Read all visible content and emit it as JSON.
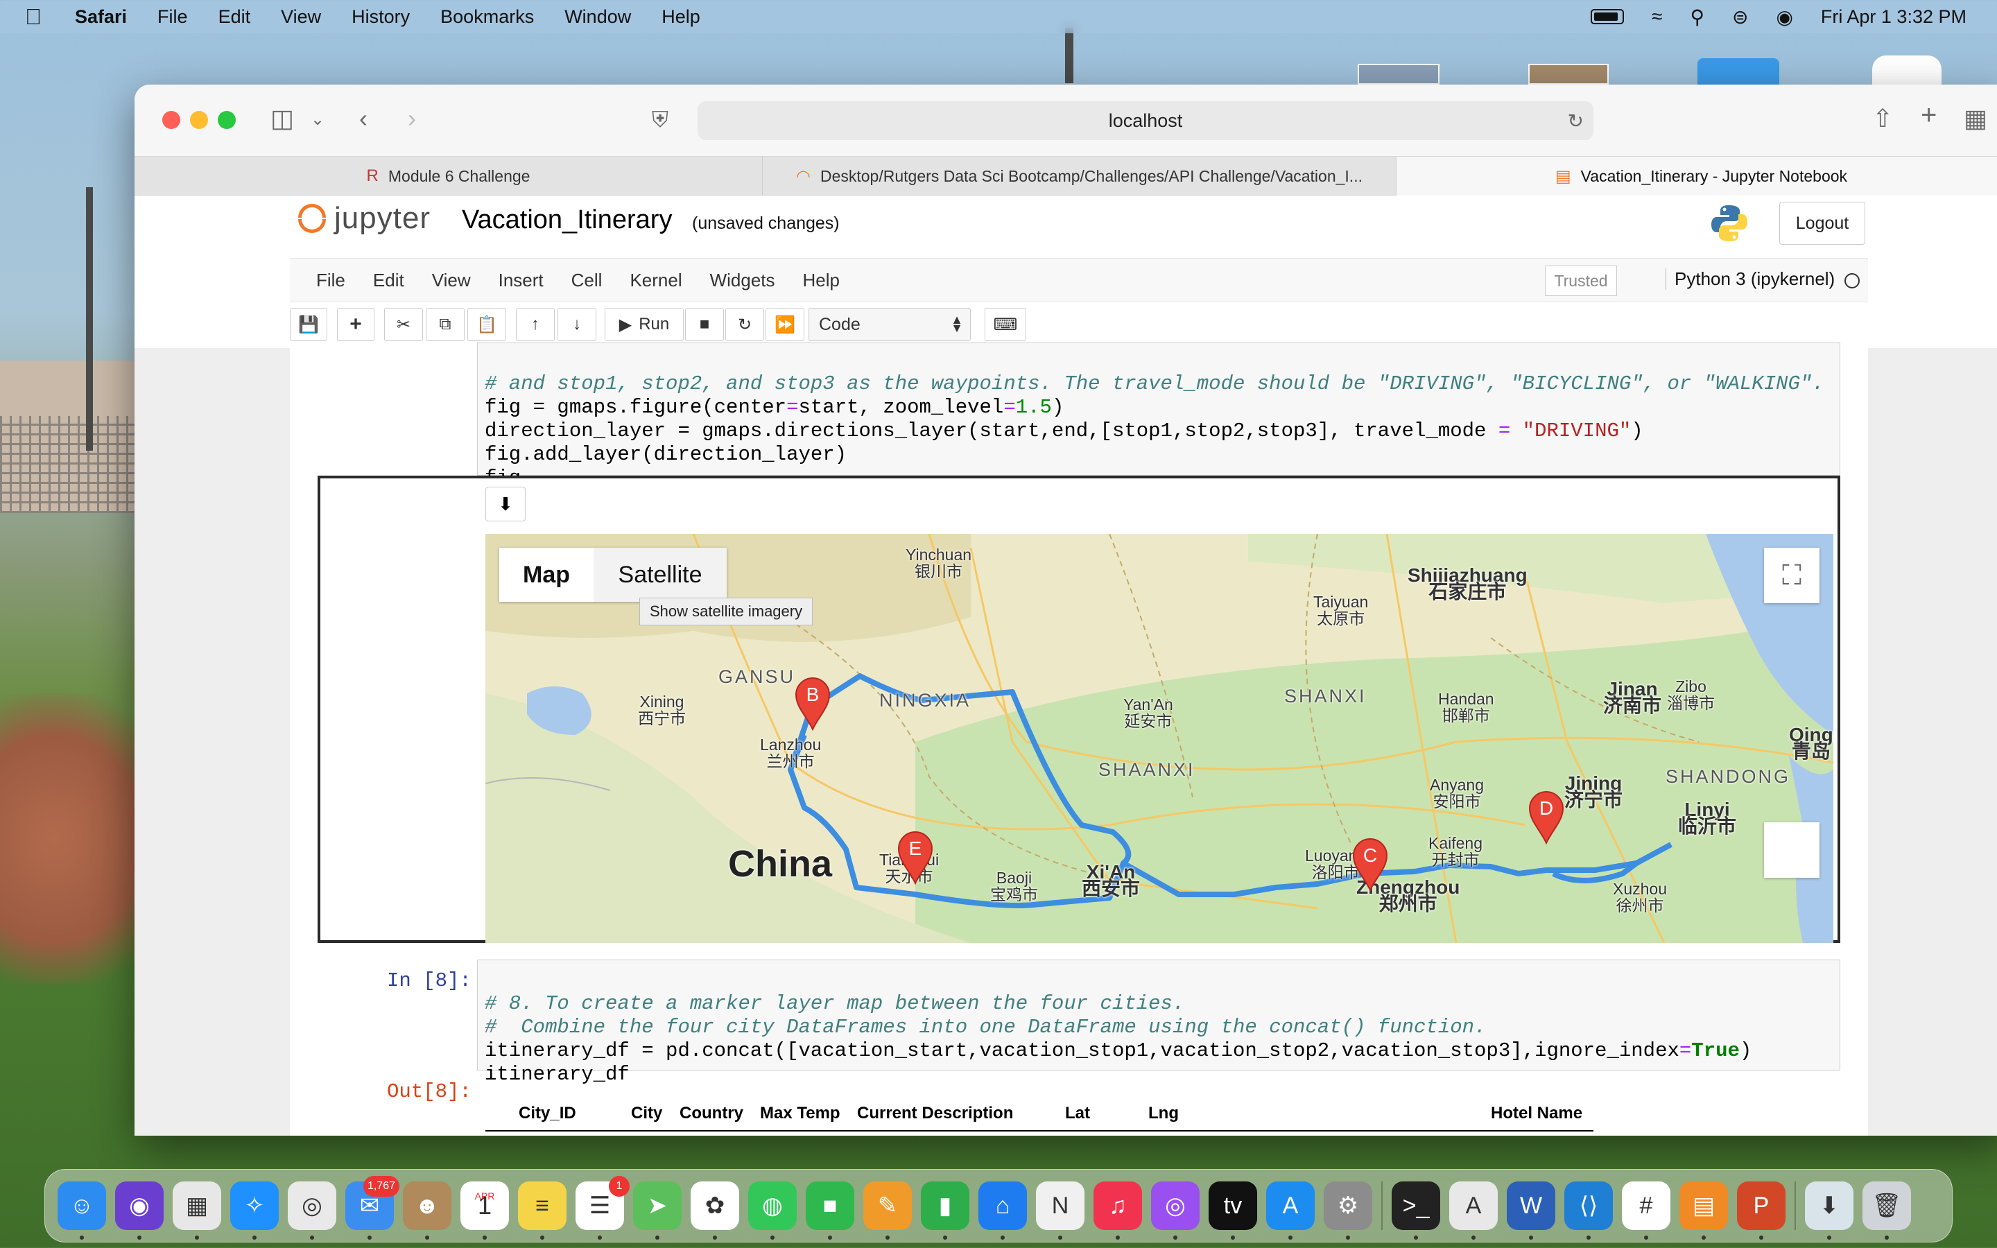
{
  "menubar": {
    "app": "Safari",
    "items": [
      "File",
      "Edit",
      "View",
      "History",
      "Bookmarks",
      "Window",
      "Help"
    ],
    "clock": "Fri Apr 1  3:32 PM"
  },
  "browser": {
    "url": "localhost",
    "tabs": [
      {
        "label": "Module 6 Challenge",
        "icon": "r-icon"
      },
      {
        "label": "Desktop/Rutgers Data Sci Bootcamp/Challenges/API Challenge/Vacation_I...",
        "icon": "jupyter-icon"
      },
      {
        "label": "Vacation_Itinerary - Jupyter Notebook",
        "icon": "notebook-icon"
      }
    ]
  },
  "jupyter": {
    "logo_text": "jupyter",
    "notebook_title": "Vacation_Itinerary",
    "status": "(unsaved changes)",
    "logout": "Logout",
    "menu": [
      "File",
      "Edit",
      "View",
      "Insert",
      "Cell",
      "Kernel",
      "Widgets",
      "Help"
    ],
    "trusted": "Trusted",
    "kernel": "Python 3 (ipykernel)",
    "toolbar": {
      "run_label": "Run",
      "cell_type": "Code"
    }
  },
  "cells": {
    "cell7": {
      "line1_comment": "# and stop1, stop2, and stop3 as the waypoints. The travel_mode should be \"DRIVING\", \"BICYCLING\", or \"WALKING\".",
      "line2_a": "fig = gmaps.figure(center",
      "line2_op": "=",
      "line2_b": "start, zoom_level",
      "line2_op2": "=",
      "line2_num": "1.5",
      "line2_c": ")",
      "line3_a": "direction_layer = gmaps.directions_layer(start,end,[stop1,stop2,stop3], travel_mode ",
      "line3_op": "=",
      "line3_str": "\"DRIVING\"",
      "line3_b": ")",
      "line4": "fig.add_layer(direction_layer)",
      "line5": "fig"
    },
    "cell8": {
      "prompt": "In [8]:",
      "line1": "# 8. To create a marker layer map between the four cities.",
      "line2": "#  Combine the four city DataFrames into one DataFrame using the concat() function.",
      "line3_a": "itinerary_df = pd.concat([vacation_start,vacation_stop1,vacation_stop2,vacation_stop3],ignore_index",
      "line3_op": "=",
      "line3_kw": "True",
      "line3_b": ")",
      "line4": "itinerary_df",
      "out_prompt": "Out[8]:"
    }
  },
  "map": {
    "type_map": "Map",
    "type_satellite": "Satellite",
    "tooltip": "Show satellite imagery",
    "markers": [
      "B",
      "E",
      "C",
      "D"
    ],
    "labels": {
      "yinchuan_en": "Yinchuan",
      "yinchuan_zh": "银川市",
      "shijiazhuang_en": "Shijiazhuang",
      "shijiazhuang_zh": "石家庄市",
      "taiyuan_en": "Taiyuan",
      "taiyuan_zh": "太原市",
      "gansu": "GANSU",
      "ningxia": "NINGXIA",
      "xining_en": "Xining",
      "xining_zh": "西宁市",
      "lanzhou_en": "Lanzhou",
      "lanzhou_zh": "兰州市",
      "yanan_en": "Yan'An",
      "yanan_zh": "延安市",
      "shanxi": "SHANXI",
      "handan_en": "Handan",
      "handan_zh": "邯郸市",
      "jinan_en": "Jinan",
      "jinan_zh": "济南市",
      "zibo_en": "Zibo",
      "zibo_zh": "淄博市",
      "qing_en": "Qing",
      "qing_zh": "青岛",
      "shaanxi": "SHAANXI",
      "anyang_en": "Anyang",
      "anyang_zh": "安阳市",
      "jining_en": "Jining",
      "jining_zh": "济宁市",
      "shandong": "SHANDONG",
      "linyi_en": "Linyi",
      "linyi_zh": "临沂市",
      "china": "China",
      "tianshui_en": "Tianshui",
      "tianshui_zh": "天水市",
      "baoji_en": "Baoji",
      "baoji_zh": "宝鸡市",
      "xian_en": "Xi'An",
      "xian_zh": "西安市",
      "luoyang_en": "Luoyang",
      "luoyang_zh": "洛阳市",
      "kaifeng_en": "Kaifeng",
      "kaifeng_zh": "开封市",
      "zhengzhou_en": "Zhengzhou",
      "zhengzhou_zh": "郑州市",
      "xuzhou_en": "Xuzhou",
      "xuzhou_zh": "徐州市"
    }
  },
  "table": {
    "headers": [
      "City_ID",
      "City",
      "Country",
      "Max Temp",
      "Current Description",
      "Lat",
      "Lng",
      "Hotel Name"
    ]
  },
  "dock": {
    "apps": [
      {
        "name": "finder",
        "color": "#2d8cf0",
        "glyph": "☺"
      },
      {
        "name": "siri",
        "color": "#6a3fd0",
        "glyph": "◉"
      },
      {
        "name": "launchpad",
        "color": "#e7e7e7",
        "glyph": "▦"
      },
      {
        "name": "safari",
        "color": "#1e90ff",
        "glyph": "✧"
      },
      {
        "name": "chrome",
        "color": "#e9e9e9",
        "glyph": "◎"
      },
      {
        "name": "mail",
        "color": "#3b8ef0",
        "glyph": "✉",
        "badge": "1,767"
      },
      {
        "name": "contacts",
        "color": "#b08a5a",
        "glyph": "☻"
      },
      {
        "name": "calendar",
        "color": "#ffffff",
        "glyph": "1",
        "top": "APR"
      },
      {
        "name": "notes",
        "color": "#f5d547",
        "glyph": "≡"
      },
      {
        "name": "reminders",
        "color": "#ffffff",
        "glyph": "☰",
        "badge": "1"
      },
      {
        "name": "maps",
        "color": "#5bbf5b",
        "glyph": "➤"
      },
      {
        "name": "photos",
        "color": "#ffffff",
        "glyph": "✿"
      },
      {
        "name": "messages",
        "color": "#33c759",
        "glyph": "◍"
      },
      {
        "name": "facetime",
        "color": "#2fb84e",
        "glyph": "■"
      },
      {
        "name": "pages",
        "color": "#f09a2a",
        "glyph": "✎"
      },
      {
        "name": "numbers",
        "color": "#2dae4a",
        "glyph": "▮"
      },
      {
        "name": "keynote",
        "color": "#1e7cf0",
        "glyph": "⌂"
      },
      {
        "name": "news",
        "color": "#f0f0f0",
        "glyph": "N"
      },
      {
        "name": "music",
        "color": "#f2334f",
        "glyph": "♫"
      },
      {
        "name": "podcasts",
        "color": "#9a4ff0",
        "glyph": "◎"
      },
      {
        "name": "tv",
        "color": "#111111",
        "glyph": "tv"
      },
      {
        "name": "app-store",
        "color": "#1d8cf0",
        "glyph": "A"
      },
      {
        "name": "system-preferences",
        "color": "#8c8c8c",
        "glyph": "⚙"
      },
      {
        "name": "terminal",
        "color": "#222222",
        "glyph": ">_"
      },
      {
        "name": "acrobat",
        "color": "#e8e8e8",
        "glyph": "A"
      },
      {
        "name": "word",
        "color": "#2b5fb8",
        "glyph": "W"
      },
      {
        "name": "vscode",
        "color": "#1f7fd4",
        "glyph": "⟨⟩"
      },
      {
        "name": "slack",
        "color": "#ffffff",
        "glyph": "#"
      },
      {
        "name": "books",
        "color": "#f08a24",
        "glyph": "▤"
      },
      {
        "name": "powerpoint",
        "color": "#d24726",
        "glyph": "P"
      },
      {
        "name": "downloads",
        "color": "#d9e3ea",
        "glyph": "⬇"
      },
      {
        "name": "trash",
        "color": "#d0d4d8",
        "glyph": "🗑"
      }
    ]
  }
}
